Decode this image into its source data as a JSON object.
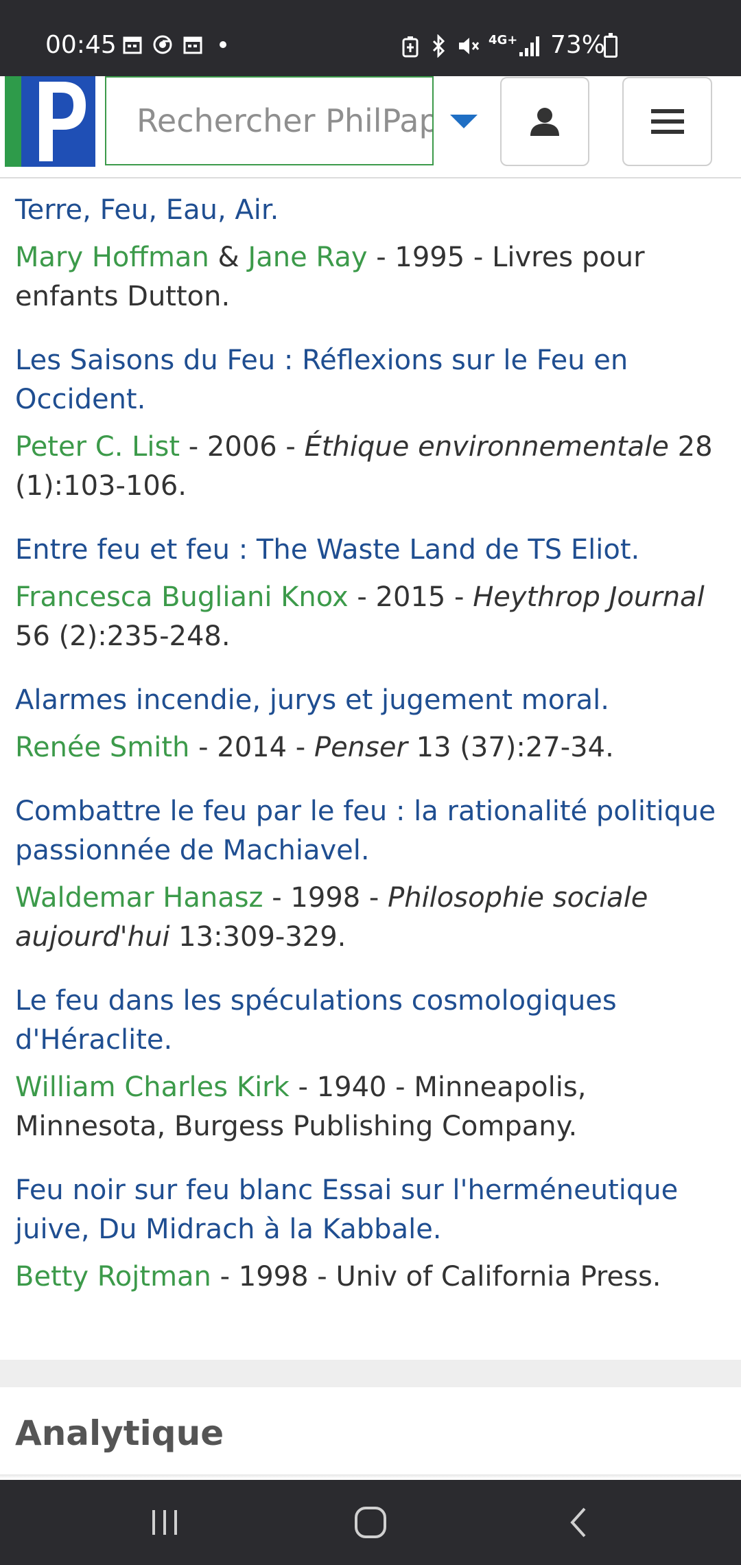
{
  "status_bar": {
    "time": "00:45",
    "battery": "73%",
    "network": "4G+"
  },
  "header": {
    "logo_letter": "P",
    "search": {
      "placeholder": "Rechercher PhilPapers",
      "value": ""
    }
  },
  "results": [
    {
      "title": "Terre, Feu, Eau, Air.",
      "authors": [
        "Mary Hoffman",
        "Jane Ray"
      ],
      "author_sep": " & ",
      "year": "1995",
      "publication_plain": "Livres pour enfants Dutton.",
      "publication_italic": "",
      "publication_tail": ""
    },
    {
      "title": "Les Saisons du Feu : Réflexions sur le Feu en Occident.",
      "authors": [
        "Peter C. List"
      ],
      "author_sep": "",
      "year": "2006",
      "publication_plain": "",
      "publication_italic": "Éthique environnementale",
      "publication_tail": " 28 (1):103-106."
    },
    {
      "title": "Entre feu et feu : The Waste Land de TS Eliot.",
      "authors": [
        "Francesca Bugliani Knox"
      ],
      "author_sep": "",
      "year": "2015",
      "publication_plain": "",
      "publication_italic": "Heythrop Journal",
      "publication_tail": " 56 (2):235-248."
    },
    {
      "title": "Alarmes incendie, jurys et jugement moral.",
      "authors": [
        "Renée Smith"
      ],
      "author_sep": "",
      "year": "2014",
      "publication_plain": "",
      "publication_italic": "Penser",
      "publication_tail": " 13 (37):27-34."
    },
    {
      "title": "Combattre le feu par le feu : la rationalité politique passionnée de Machiavel.",
      "authors": [
        "Waldemar Hanasz"
      ],
      "author_sep": "",
      "year": "1998",
      "publication_plain": "",
      "publication_italic": "Philosophie sociale aujourd'hui",
      "publication_tail": " 13:309-329."
    },
    {
      "title": "Le feu dans les spéculations cosmologiques d'Héraclite.",
      "authors": [
        "William Charles Kirk"
      ],
      "author_sep": "",
      "year": "1940",
      "publication_plain": "Minneapolis, Minnesota, Burgess Publishing Company.",
      "publication_italic": "",
      "publication_tail": ""
    },
    {
      "title": "Feu noir sur feu blanc Essai sur l'herméneutique juive, Du Midrach à la Kabbale.",
      "authors": [
        "Betty Rojtman"
      ],
      "author_sep": "",
      "year": "1998",
      "publication_plain": "Univ of California Press.",
      "publication_italic": "",
      "publication_tail": ""
    }
  ],
  "separator": " - ",
  "section": {
    "title": "Analytique"
  },
  "colors": {
    "title_link": "#1f4e91",
    "author_link": "#3c9a4a",
    "logo_green": "#2e9b4a",
    "logo_blue": "#1f4fb5",
    "dropdown_caret": "#1f6fc4",
    "system_bar": "#2b2b2f"
  }
}
